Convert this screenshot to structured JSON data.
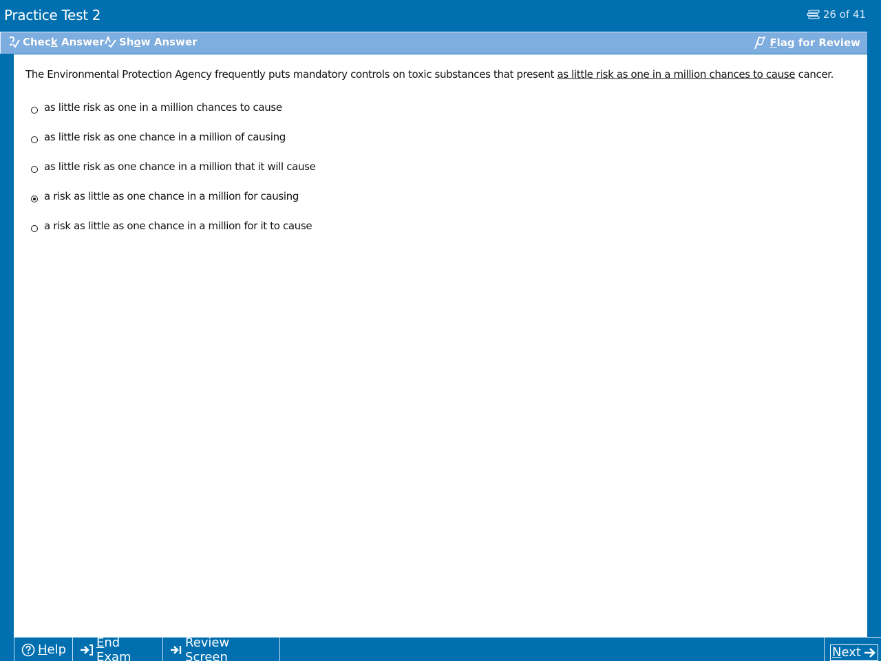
{
  "titlebar": {
    "title": "Practice Test 2",
    "counter": "26 of 41"
  },
  "toolbar": {
    "check_answer": {
      "pre": "Chec",
      "key": "k",
      "post": " Answer"
    },
    "show_answer": {
      "pre": "Sh",
      "key": "o",
      "post": "w Answer"
    },
    "flag_review": {
      "pre": "",
      "key": "F",
      "post": "lag for Review"
    }
  },
  "question": {
    "text_before": "The Environmental Protection Agency frequently puts mandatory controls on toxic substances that present ",
    "text_underlined": "as little risk as one in a million chances to cause",
    "text_after": " cancer.",
    "options": [
      {
        "label": "as little risk as one in a million chances to cause",
        "selected": false
      },
      {
        "label": "as little risk as one chance in a million of causing",
        "selected": false
      },
      {
        "label": "as little risk as one chance in a million that it will cause",
        "selected": false
      },
      {
        "label": "a risk as little as one chance in a million for causing",
        "selected": true
      },
      {
        "label": "a risk as little as one chance in a million for it to cause",
        "selected": false
      }
    ]
  },
  "bottombar": {
    "help": {
      "pre": "",
      "key": "H",
      "post": "elp"
    },
    "end_exam": {
      "pre": "",
      "key": "E",
      "post": "nd Exam"
    },
    "review_screen": {
      "pre": "Review ",
      "key": "S",
      "post": "creen"
    },
    "next": {
      "pre": "",
      "key": "N",
      "post": "ext"
    }
  },
  "colors": {
    "frame_blue": "#006faf",
    "toolbar_blue": "#7eaddf",
    "content_bg": "#ffffff"
  }
}
